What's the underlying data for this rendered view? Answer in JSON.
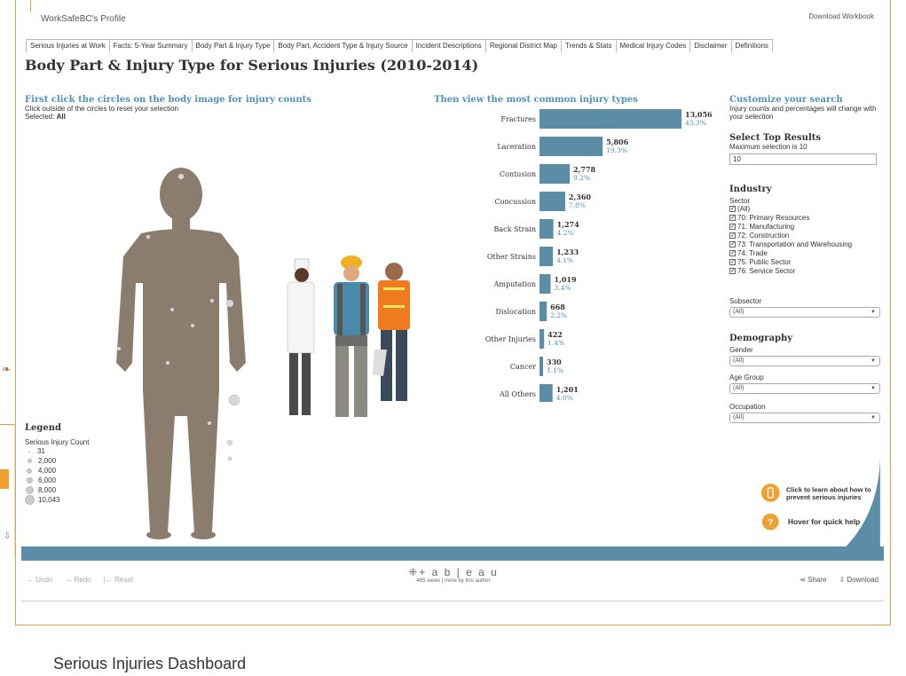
{
  "header": {
    "profile": "WorkSafeBC's Profile",
    "download_workbook": "Download Workbook"
  },
  "tabs": [
    "Serious Injuries at Work",
    "Facts: 5-Year Summary",
    "Body Part & Injury Type",
    "Body Part, Accident Type & Injury Source",
    "Incident Descriptions",
    "Regional District Map",
    "Trends & Stats",
    "Medical Injury Codes",
    "Disclaimer",
    "Definitions"
  ],
  "dashboard": {
    "title": "Body Part & Injury Type for Serious Injuries (2010-2014)",
    "first_heading": "First click the circles on the body image for injury counts",
    "first_sub": "Click outside of the circles to reset your selection",
    "selected_label": "Selected:",
    "selected_value": "All",
    "then_heading": "Then view the most common injury types"
  },
  "legend": {
    "title": "Legend",
    "subtitle": "Serious Injury Count",
    "items": [
      "31",
      "2,000",
      "4,000",
      "6,000",
      "8,000",
      "10,043"
    ]
  },
  "chart_data": {
    "type": "bar",
    "orientation": "horizontal",
    "categories": [
      "Fractures",
      "Laceration",
      "Contusion",
      "Concussion",
      "Back Strain",
      "Other Strains",
      "Amputation",
      "Dislocation",
      "Other Injuries",
      "Cancer",
      "All Others"
    ],
    "values": [
      13056,
      5806,
      2778,
      2360,
      1274,
      1233,
      1019,
      668,
      422,
      330,
      1201
    ],
    "value_labels": [
      "13,056",
      "5,806",
      "2,778",
      "2,360",
      "1,274",
      "1,233",
      "1,019",
      "668",
      "422",
      "330",
      "1,201"
    ],
    "percent_labels": [
      "43.3%",
      "19.3%",
      "9.2%",
      "7.8%",
      "4.2%",
      "4.1%",
      "3.4%",
      "2.2%",
      "1.4%",
      "1.1%",
      "4.0%"
    ],
    "bar_color": "#5b8ea6",
    "percent_color": "#4f92b5"
  },
  "right_panel": {
    "customize_heading": "Customize your search",
    "customize_sub": "Injury counts and percentages will change with your selection",
    "top_results_heading": "Select Top Results",
    "top_results_sub": "Maximum selection is 10",
    "top_results_value": "10",
    "industry_heading": "Industry",
    "sector_label": "Sector",
    "sectors": [
      "(All)",
      "70: Primary Resources",
      "71: Manufacturing",
      "72: Construction",
      "73: Transportation and Warehousing",
      "74: Trade",
      "75: Public Sector",
      "76: Service Sector"
    ],
    "subsector_label": "Subsector",
    "subsector_value": "(All)",
    "demography_heading": "Demography",
    "gender_label": "Gender",
    "gender_value": "(All)",
    "age_label": "Age Group",
    "age_value": "(All)",
    "occupation_label": "Occupation",
    "occupation_value": "(All)"
  },
  "help": {
    "learn_text": "Click to learn about how to prevent serious injuries",
    "quick_help": "Hover for quick help",
    "info_icon": "i",
    "question_icon": "?"
  },
  "toolbar": {
    "undo": "Undo",
    "redo": "Redo",
    "reset": "Reset",
    "brand": "+ a b | e a u",
    "views": "485 views | more by this author",
    "share": "Share",
    "download": "Download"
  },
  "footer": {
    "title": "Serious Injuries Dashboard"
  },
  "colors": {
    "accent": "#4f92b5",
    "band": "#5b8ea6",
    "body": "#8a7d6d",
    "orange": "#f0a030",
    "frame": "#e8a23a"
  }
}
